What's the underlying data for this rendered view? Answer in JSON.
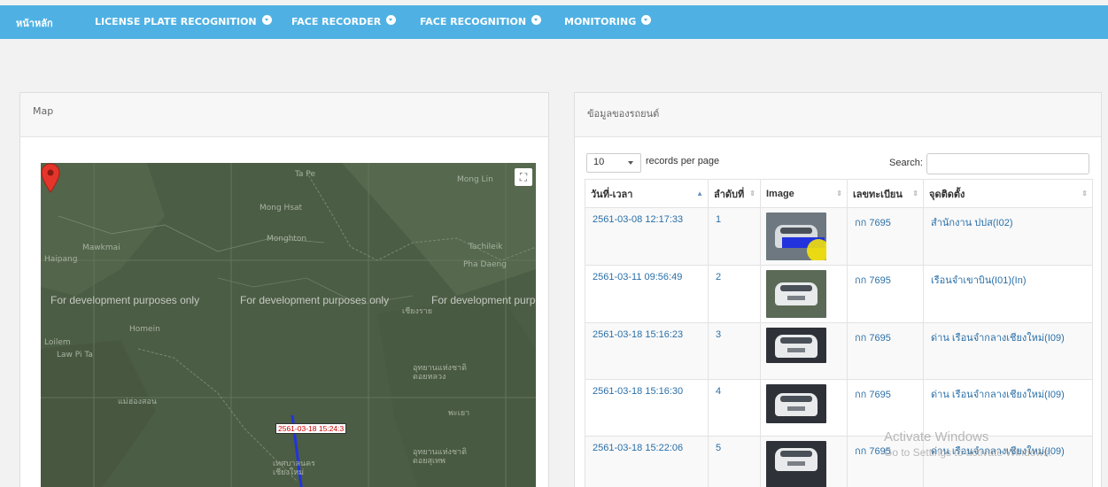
{
  "nav": {
    "home": "หน้าหลัก",
    "items": [
      {
        "label": "LICENSE PLATE RECOGNITION"
      },
      {
        "label": "FACE RECORDER"
      },
      {
        "label": "FACE RECOGNITION"
      },
      {
        "label": "MONITORING"
      }
    ]
  },
  "map_panel": {
    "title": "Map",
    "dev_notice": "For development purposes only",
    "marker_label": "2561-03-18 15:24:3",
    "place_labels": [
      "Ta Pe",
      "Mong Hsat",
      "Monghton",
      "Mawkmai",
      "Haipang",
      "Homein",
      "Loilem",
      "Law Pi Ta",
      "Pha Daeng",
      "Mong Lin",
      "Tachileik",
      "เชียงราย",
      "อุทยานแห่งชาติ ดอยหลวง",
      "แม่ฮ่องสอน",
      "พะเยา",
      "อุทยานแห่งชาติ ดอยสุเทพ",
      "เทศบาลนคร เชียงใหม่"
    ]
  },
  "data_panel": {
    "title": "ข้อมูลของรถยนต์",
    "page_length": "10",
    "records_label": "records per page",
    "search_label": "Search:",
    "search_placeholder": "",
    "columns": [
      "วันที่-เวลา",
      "ลำดับที่",
      "Image",
      "เลขทะเบียน",
      "จุดติดตั้ง"
    ],
    "rows": [
      {
        "datetime": "2561-03-08 12:17:33",
        "seq": "1",
        "plate": "กก 7695",
        "location": "สำนักงาน ปปส(I02)"
      },
      {
        "datetime": "2561-03-11 09:56:49",
        "seq": "2",
        "plate": "กก 7695",
        "location": "เรือนจำเขาบิน(I01)(In)"
      },
      {
        "datetime": "2561-03-18 15:16:23",
        "seq": "3",
        "plate": "กก 7695",
        "location": "ด่าน เรือนจำกลางเชียงใหม่(I09)"
      },
      {
        "datetime": "2561-03-18 15:16:30",
        "seq": "4",
        "plate": "กก 7695",
        "location": "ด่าน เรือนจำกลางเชียงใหม่(I09)"
      },
      {
        "datetime": "2561-03-18 15:22:06",
        "seq": "5",
        "plate": "กก 7695",
        "location": "ด่าน เรือนจำกลางเชียงใหม่(I09)"
      }
    ]
  },
  "os_watermark": {
    "line1": "Activate Windows",
    "line2": "Go to Settings to activate Windows."
  },
  "colors": {
    "topbar": "#4fb1e3",
    "link": "#2a6fa8",
    "map_bg": "#4c5d45",
    "route": "#2233dd",
    "marker": "#e5352a"
  }
}
